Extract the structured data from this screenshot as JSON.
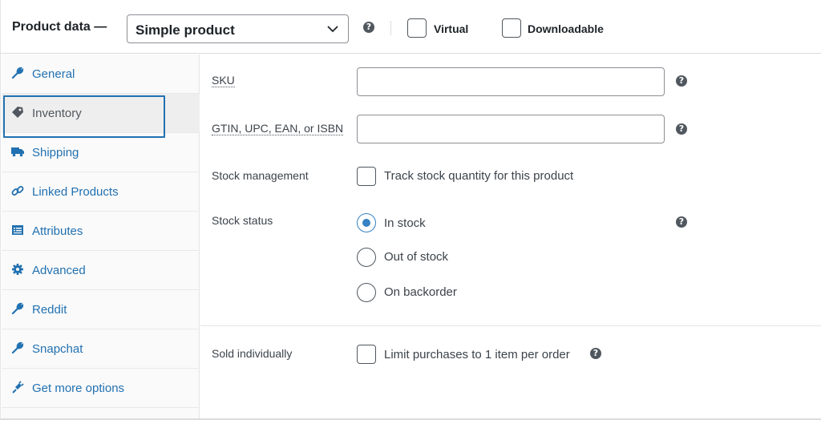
{
  "header": {
    "title": "Product data —",
    "product_type": "Simple product",
    "virtual_label": "Virtual",
    "downloadable_label": "Downloadable",
    "help_glyph": "?"
  },
  "sidebar": {
    "items": [
      {
        "label": "General",
        "icon": "wrench-icon"
      },
      {
        "label": "Inventory",
        "icon": "tag-icon"
      },
      {
        "label": "Shipping",
        "icon": "truck-icon"
      },
      {
        "label": "Linked Products",
        "icon": "link-icon"
      },
      {
        "label": "Attributes",
        "icon": "list-icon"
      },
      {
        "label": "Advanced",
        "icon": "gear-icon"
      },
      {
        "label": "Reddit",
        "icon": "wrench-icon"
      },
      {
        "label": "Snapchat",
        "icon": "wrench-icon"
      },
      {
        "label": "Get more options",
        "icon": "plug-icon"
      }
    ],
    "active_index": 1
  },
  "fields": {
    "sku": {
      "label": "SKU",
      "value": ""
    },
    "gtin": {
      "label": "GTIN, UPC, EAN, or ISBN",
      "value": ""
    },
    "stock_management": {
      "label": "Stock management",
      "checkbox_label": "Track stock quantity for this product"
    },
    "stock_status": {
      "label": "Stock status",
      "options": [
        "In stock",
        "Out of stock",
        "On backorder"
      ],
      "selected": "In stock"
    },
    "sold_individually": {
      "label": "Sold individually",
      "checkbox_label": "Limit purchases to 1 item per order"
    }
  },
  "colors": {
    "link": "#2271b1",
    "radio_selected": "#3582c4",
    "focus": "#2271b1"
  }
}
